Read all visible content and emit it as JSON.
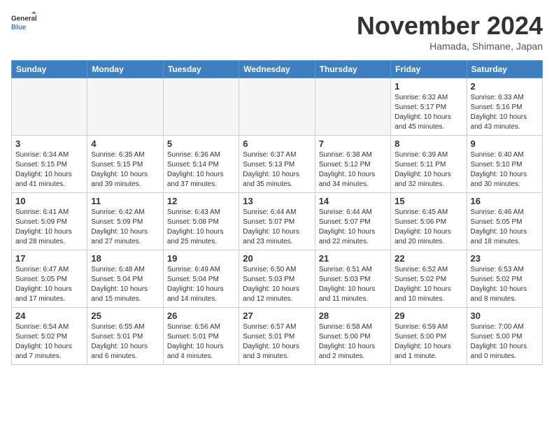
{
  "logo": {
    "line1": "General",
    "line2": "Blue"
  },
  "title": "November 2024",
  "location": "Hamada, Shimane, Japan",
  "weekdays": [
    "Sunday",
    "Monday",
    "Tuesday",
    "Wednesday",
    "Thursday",
    "Friday",
    "Saturday"
  ],
  "weeks": [
    [
      {
        "day": "",
        "info": ""
      },
      {
        "day": "",
        "info": ""
      },
      {
        "day": "",
        "info": ""
      },
      {
        "day": "",
        "info": ""
      },
      {
        "day": "",
        "info": ""
      },
      {
        "day": "1",
        "info": "Sunrise: 6:32 AM\nSunset: 5:17 PM\nDaylight: 10 hours\nand 45 minutes."
      },
      {
        "day": "2",
        "info": "Sunrise: 6:33 AM\nSunset: 5:16 PM\nDaylight: 10 hours\nand 43 minutes."
      }
    ],
    [
      {
        "day": "3",
        "info": "Sunrise: 6:34 AM\nSunset: 5:15 PM\nDaylight: 10 hours\nand 41 minutes."
      },
      {
        "day": "4",
        "info": "Sunrise: 6:35 AM\nSunset: 5:15 PM\nDaylight: 10 hours\nand 39 minutes."
      },
      {
        "day": "5",
        "info": "Sunrise: 6:36 AM\nSunset: 5:14 PM\nDaylight: 10 hours\nand 37 minutes."
      },
      {
        "day": "6",
        "info": "Sunrise: 6:37 AM\nSunset: 5:13 PM\nDaylight: 10 hours\nand 35 minutes."
      },
      {
        "day": "7",
        "info": "Sunrise: 6:38 AM\nSunset: 5:12 PM\nDaylight: 10 hours\nand 34 minutes."
      },
      {
        "day": "8",
        "info": "Sunrise: 6:39 AM\nSunset: 5:11 PM\nDaylight: 10 hours\nand 32 minutes."
      },
      {
        "day": "9",
        "info": "Sunrise: 6:40 AM\nSunset: 5:10 PM\nDaylight: 10 hours\nand 30 minutes."
      }
    ],
    [
      {
        "day": "10",
        "info": "Sunrise: 6:41 AM\nSunset: 5:09 PM\nDaylight: 10 hours\nand 28 minutes."
      },
      {
        "day": "11",
        "info": "Sunrise: 6:42 AM\nSunset: 5:09 PM\nDaylight: 10 hours\nand 27 minutes."
      },
      {
        "day": "12",
        "info": "Sunrise: 6:43 AM\nSunset: 5:08 PM\nDaylight: 10 hours\nand 25 minutes."
      },
      {
        "day": "13",
        "info": "Sunrise: 6:44 AM\nSunset: 5:07 PM\nDaylight: 10 hours\nand 23 minutes."
      },
      {
        "day": "14",
        "info": "Sunrise: 6:44 AM\nSunset: 5:07 PM\nDaylight: 10 hours\nand 22 minutes."
      },
      {
        "day": "15",
        "info": "Sunrise: 6:45 AM\nSunset: 5:06 PM\nDaylight: 10 hours\nand 20 minutes."
      },
      {
        "day": "16",
        "info": "Sunrise: 6:46 AM\nSunset: 5:05 PM\nDaylight: 10 hours\nand 18 minutes."
      }
    ],
    [
      {
        "day": "17",
        "info": "Sunrise: 6:47 AM\nSunset: 5:05 PM\nDaylight: 10 hours\nand 17 minutes."
      },
      {
        "day": "18",
        "info": "Sunrise: 6:48 AM\nSunset: 5:04 PM\nDaylight: 10 hours\nand 15 minutes."
      },
      {
        "day": "19",
        "info": "Sunrise: 6:49 AM\nSunset: 5:04 PM\nDaylight: 10 hours\nand 14 minutes."
      },
      {
        "day": "20",
        "info": "Sunrise: 6:50 AM\nSunset: 5:03 PM\nDaylight: 10 hours\nand 12 minutes."
      },
      {
        "day": "21",
        "info": "Sunrise: 6:51 AM\nSunset: 5:03 PM\nDaylight: 10 hours\nand 11 minutes."
      },
      {
        "day": "22",
        "info": "Sunrise: 6:52 AM\nSunset: 5:02 PM\nDaylight: 10 hours\nand 10 minutes."
      },
      {
        "day": "23",
        "info": "Sunrise: 6:53 AM\nSunset: 5:02 PM\nDaylight: 10 hours\nand 8 minutes."
      }
    ],
    [
      {
        "day": "24",
        "info": "Sunrise: 6:54 AM\nSunset: 5:02 PM\nDaylight: 10 hours\nand 7 minutes."
      },
      {
        "day": "25",
        "info": "Sunrise: 6:55 AM\nSunset: 5:01 PM\nDaylight: 10 hours\nand 6 minutes."
      },
      {
        "day": "26",
        "info": "Sunrise: 6:56 AM\nSunset: 5:01 PM\nDaylight: 10 hours\nand 4 minutes."
      },
      {
        "day": "27",
        "info": "Sunrise: 6:57 AM\nSunset: 5:01 PM\nDaylight: 10 hours\nand 3 minutes."
      },
      {
        "day": "28",
        "info": "Sunrise: 6:58 AM\nSunset: 5:00 PM\nDaylight: 10 hours\nand 2 minutes."
      },
      {
        "day": "29",
        "info": "Sunrise: 6:59 AM\nSunset: 5:00 PM\nDaylight: 10 hours\nand 1 minute."
      },
      {
        "day": "30",
        "info": "Sunrise: 7:00 AM\nSunset: 5:00 PM\nDaylight: 10 hours\nand 0 minutes."
      }
    ]
  ]
}
